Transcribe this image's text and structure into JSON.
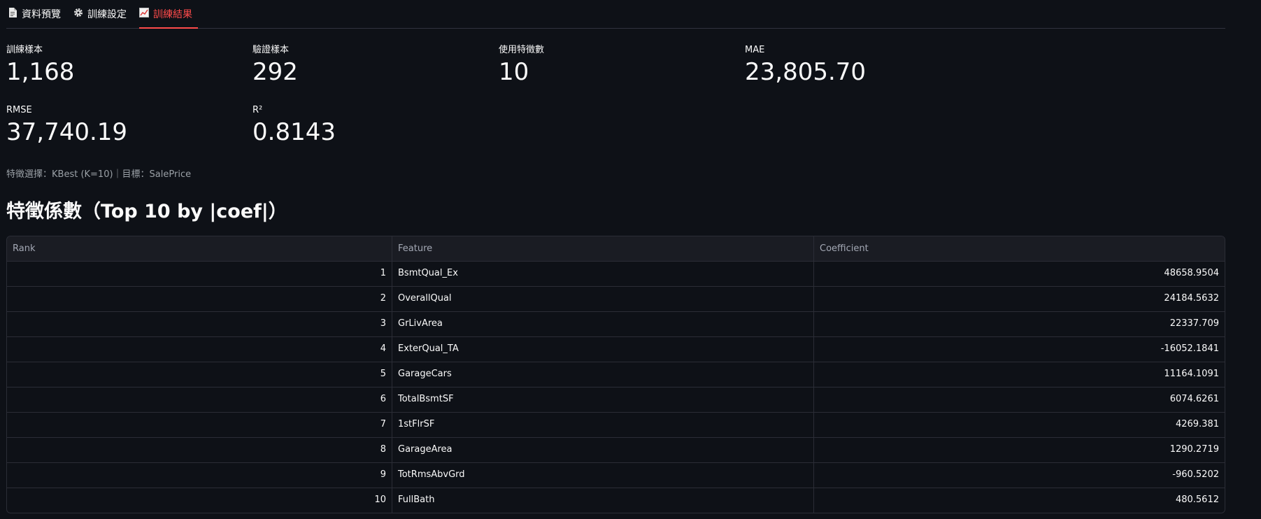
{
  "tabs": [
    {
      "label": "資料預覽",
      "icon": "document-icon"
    },
    {
      "label": "訓練設定",
      "icon": "gear-icon"
    },
    {
      "label": "訓練結果",
      "icon": "chart-icon",
      "active": true
    }
  ],
  "metrics": [
    {
      "label": "訓練樣本",
      "value": "1,168"
    },
    {
      "label": "驗證樣本",
      "value": "292"
    },
    {
      "label": "使用特徵數",
      "value": "10"
    },
    {
      "label": "MAE",
      "value": "23,805.70"
    },
    {
      "label": "RMSE",
      "value": "37,740.19"
    },
    {
      "label": "R²",
      "value": "0.8143"
    }
  ],
  "caption": "特徵選擇：KBest (K=10)｜目標：SalePrice",
  "section_title": "特徵係數（Top 10 by |coef|）",
  "table": {
    "headers": [
      "Rank",
      "Feature",
      "Coefficient"
    ],
    "rows": [
      [
        "1",
        "BsmtQual_Ex",
        "48658.9504"
      ],
      [
        "2",
        "OverallQual",
        "24184.5632"
      ],
      [
        "3",
        "GrLivArea",
        "22337.709"
      ],
      [
        "4",
        "ExterQual_TA",
        "-16052.1841"
      ],
      [
        "5",
        "GarageCars",
        "11164.1091"
      ],
      [
        "6",
        "TotalBsmtSF",
        "6074.6261"
      ],
      [
        "7",
        "1stFlrSF",
        "4269.381"
      ],
      [
        "8",
        "GarageArea",
        "1290.2719"
      ],
      [
        "9",
        "TotRmsAbvGrd",
        "-960.5202"
      ],
      [
        "10",
        "FullBath",
        "480.5612"
      ]
    ]
  },
  "colors": {
    "background": "#0e1117",
    "accent": "#ff4b4b",
    "text": "#fafafa"
  }
}
